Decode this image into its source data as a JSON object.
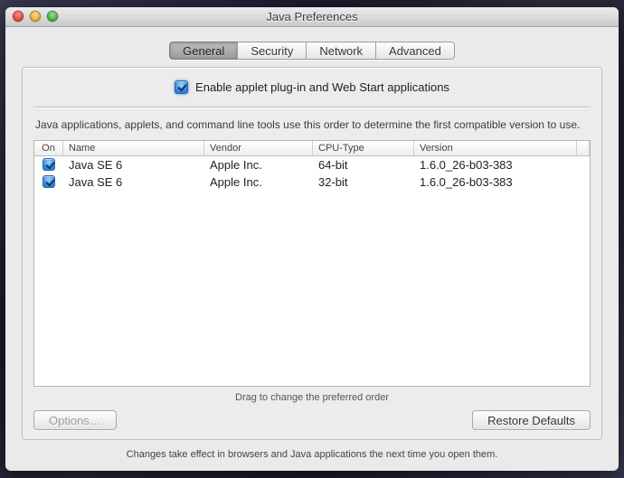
{
  "window": {
    "title": "Java Preferences"
  },
  "tabs": {
    "items": [
      {
        "label": "General"
      },
      {
        "label": "Security"
      },
      {
        "label": "Network"
      },
      {
        "label": "Advanced"
      }
    ],
    "selected_index": 0
  },
  "enable_checkbox": {
    "label": "Enable applet plug-in and Web Start applications",
    "checked": true
  },
  "explain_text": "Java applications, applets, and command line tools use this order to determine the first compatible version to use.",
  "table": {
    "headers": {
      "on": "On",
      "name": "Name",
      "vendor": "Vendor",
      "cpu": "CPU-Type",
      "version": "Version"
    },
    "rows": [
      {
        "on": true,
        "name": "Java SE 6",
        "vendor": "Apple Inc.",
        "cpu": "64-bit",
        "version": "1.6.0_26-b03-383"
      },
      {
        "on": true,
        "name": "Java SE 6",
        "vendor": "Apple Inc.",
        "cpu": "32-bit",
        "version": "1.6.0_26-b03-383"
      }
    ]
  },
  "drag_hint": "Drag to change the preferred order",
  "buttons": {
    "options": "Options…",
    "restore": "Restore Defaults"
  },
  "footer_note": "Changes take effect in browsers and Java applications the next time you open them."
}
